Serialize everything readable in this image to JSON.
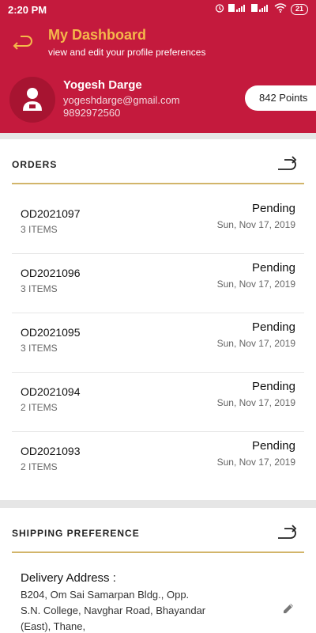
{
  "status_bar": {
    "time": "2:20 PM",
    "battery": "21"
  },
  "header": {
    "title": "My Dashboard",
    "subtitle": "view and edit your profile preferences"
  },
  "profile": {
    "name": "Yogesh Darge",
    "email": "yogeshdarge@gmail.com",
    "phone": "9892972560",
    "points": "842 Points"
  },
  "orders": {
    "heading": "ORDERS",
    "items": [
      {
        "id": "OD2021097",
        "count": "3 ITEMS",
        "status": "Pending",
        "date": "Sun, Nov 17, 2019"
      },
      {
        "id": "OD2021096",
        "count": "3 ITEMS",
        "status": "Pending",
        "date": "Sun, Nov 17, 2019"
      },
      {
        "id": "OD2021095",
        "count": "3 ITEMS",
        "status": "Pending",
        "date": "Sun, Nov 17, 2019"
      },
      {
        "id": "OD2021094",
        "count": "2 ITEMS",
        "status": "Pending",
        "date": "Sun, Nov 17, 2019"
      },
      {
        "id": "OD2021093",
        "count": "2 ITEMS",
        "status": "Pending",
        "date": "Sun, Nov 17, 2019"
      }
    ]
  },
  "shipping": {
    "heading": "SHIPPING PREFERENCE",
    "address_title": "Delivery Address :",
    "address_text": "B204, Om Sai Samarpan Bldg., Opp. S.N. College, Navghar Road, Bhayandar (East), Thane,"
  },
  "icons": {
    "back": "back-arrow-icon",
    "forward": "forward-arrow-icon",
    "edit": "pencil-icon",
    "avatar": "user-avatar-icon"
  },
  "colors": {
    "brand": "#c41a3d",
    "accent": "#f5b84b",
    "divider_gold": "#d2b56a"
  }
}
